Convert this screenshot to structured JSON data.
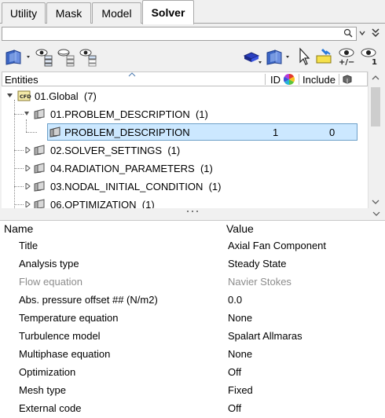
{
  "tabs": [
    {
      "label": "Utility",
      "active": false
    },
    {
      "label": "Mask",
      "active": false
    },
    {
      "label": "Model",
      "active": false
    },
    {
      "label": "Solver",
      "active": true
    }
  ],
  "search": {
    "value": "",
    "placeholder": ""
  },
  "entities_header": {
    "entities": "Entities",
    "id": "ID",
    "include": "Include"
  },
  "tree": {
    "root": {
      "label": "01.Global",
      "count": "(7)"
    },
    "items": [
      {
        "label": "01.PROBLEM_DESCRIPTION",
        "count": "(1)",
        "expanded": true
      },
      {
        "label": "PROBLEM_DESCRIPTION",
        "id": "1",
        "include": "0",
        "selected": true
      },
      {
        "label": "02.SOLVER_SETTINGS",
        "count": "(1)"
      },
      {
        "label": "04.RADIATION_PARAMETERS",
        "count": "(1)"
      },
      {
        "label": "03.NODAL_INITIAL_CONDITION",
        "count": "(1)"
      },
      {
        "label": "06.OPTIMIZATION",
        "count": "(1)"
      }
    ]
  },
  "toolbar": {
    "icons": [
      "entity-type-icon",
      "show-entity-icon",
      "hide-entity-icon",
      "isolate-entity-icon",
      "shape-icon",
      "entity-selection-icon",
      "pointer-icon",
      "highlight-icon",
      "show-hide-plus-minus-icon",
      "show-one-icon"
    ],
    "labels": {
      "plus_minus": "+/−",
      "one": "1"
    }
  },
  "properties": {
    "header_name": "Name",
    "header_value": "Value",
    "rows": [
      {
        "name": "Title",
        "value": "Axial Fan Component",
        "disabled": false
      },
      {
        "name": "Analysis type",
        "value": "Steady State",
        "disabled": false
      },
      {
        "name": "Flow equation",
        "value": "Navier Stokes",
        "disabled": true
      },
      {
        "name": "Abs. pressure offset ## (N/m2)",
        "value": "0.0",
        "disabled": false
      },
      {
        "name": "Temperature equation",
        "value": "None",
        "disabled": false
      },
      {
        "name": "Turbulence model",
        "value": "Spalart Allmaras",
        "disabled": false
      },
      {
        "name": "Multiphase equation",
        "value": "None",
        "disabled": false
      },
      {
        "name": "Optimization",
        "value": "Off",
        "disabled": false
      },
      {
        "name": "Mesh type",
        "value": "Fixed",
        "disabled": false
      },
      {
        "name": "External code",
        "value": "Off",
        "disabled": false
      }
    ]
  }
}
